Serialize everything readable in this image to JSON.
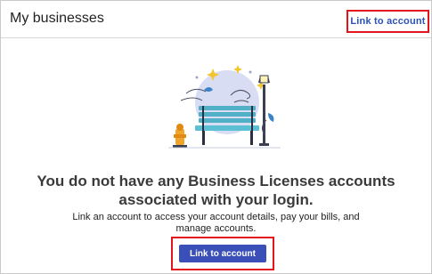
{
  "header": {
    "title": "My businesses",
    "link_label": "Link to account"
  },
  "empty_state": {
    "illustration": "park-bench-icon",
    "heading": "You do not have any Business Licenses accounts associated with your login.",
    "body": "Link an account to access your account details, pay your bills, and manage accounts.",
    "button_label": "Link to account"
  },
  "colors": {
    "accent": "#3a4fb8",
    "link": "#2a51b7",
    "highlight": "#e3141c"
  }
}
